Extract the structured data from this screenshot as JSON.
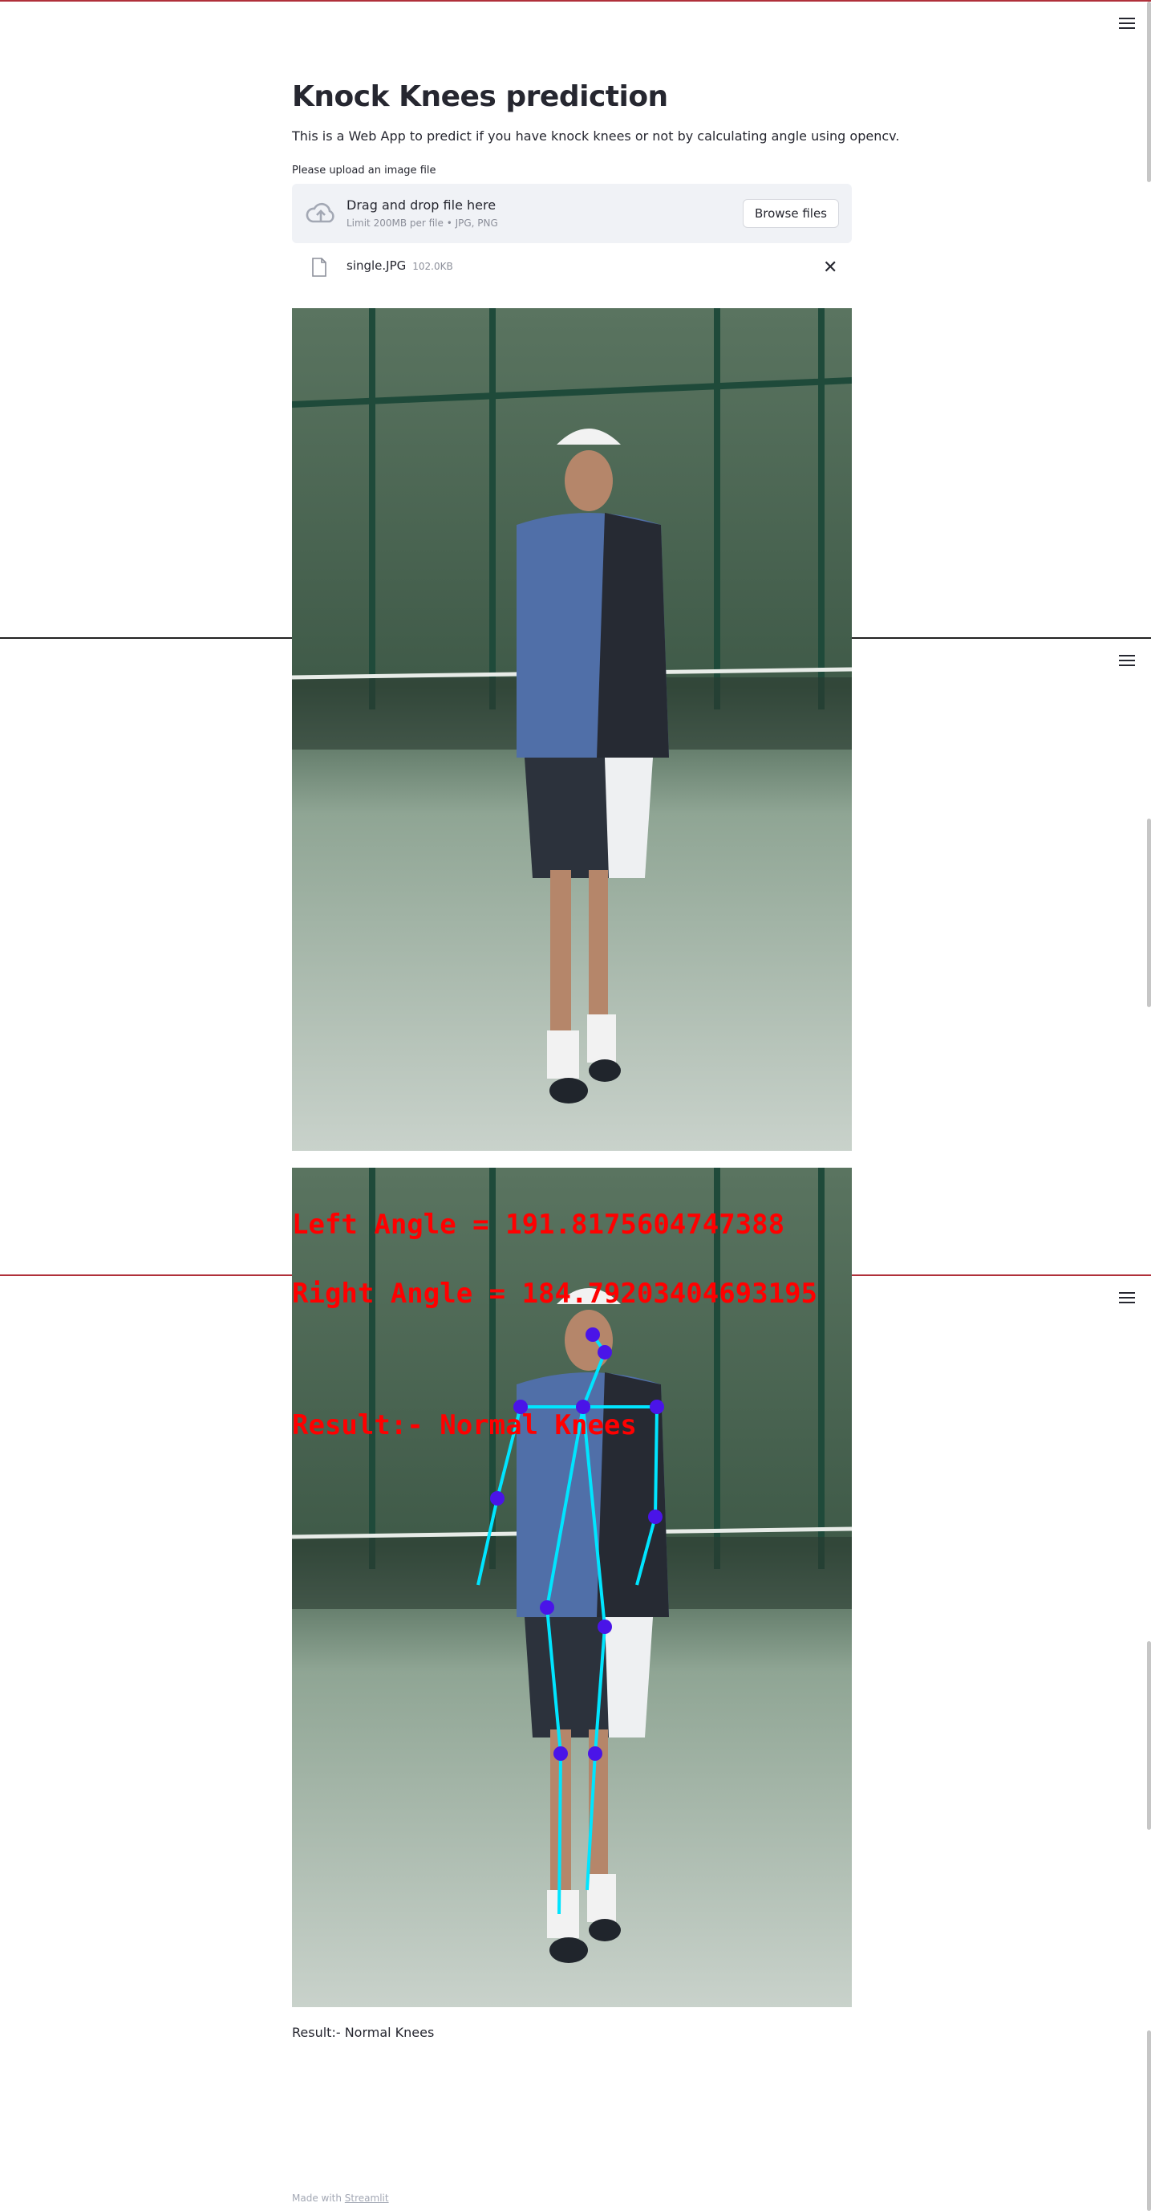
{
  "app": {
    "title": "Knock Knees prediction",
    "description": "This is a Web App to predict if you have knock knees or not by calculating angle using opencv."
  },
  "uploader": {
    "label": "Please upload an image file",
    "drop_text": "Drag and drop file here",
    "limit_text": "Limit 200MB per file • JPG, PNG",
    "browse_label": "Browse files",
    "close_glyph": "✕"
  },
  "uploaded_file": {
    "name": "single.JPG",
    "size": "102.0KB"
  },
  "annotated": {
    "left_angle": "Left Angle = 191.8175604747388",
    "right_angle": "Right Angle = 184.79203404693195",
    "result_overlay": "Result:- Normal Knees"
  },
  "result": {
    "text": "Result:- Normal Knees"
  },
  "footer": {
    "prefix": "Made with ",
    "link": "Streamlit"
  },
  "icons": {
    "menu": "hamburger-icon",
    "upload": "cloud-upload-icon",
    "file": "file-icon",
    "close": "close-icon"
  },
  "colors": {
    "accent_red": "#ff0000",
    "skeleton_line": "#00e5ff",
    "keypoint": "#4a14e8"
  }
}
